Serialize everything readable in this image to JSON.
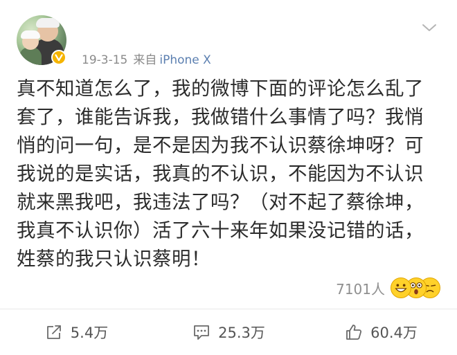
{
  "post": {
    "timestamp": "19-3-15",
    "source_prefix": "来自",
    "device": "iPhone X",
    "text": "真不知道怎么了，我的微博下面的评论怎么乱了套了，谁能告诉我，我做错什么事情了吗？我悄悄的问一句，是不是因为我不认识蔡徐坤呀？可我说的是实话，我真的不认识，不能因为不认识就来黑我吧，我违法了吗？（对不起了蔡徐坤，我真不认识你）活了六十来年如果没记错的话，姓蔡的我只认识蔡明！"
  },
  "reactions": {
    "count": "7101人",
    "emojis": [
      "grin-emoji",
      "surprised-emoji",
      "sad-emoji"
    ]
  },
  "actions": {
    "repost": {
      "icon": "repost-icon",
      "label": "5.4万"
    },
    "comment": {
      "icon": "comment-icon",
      "label": "25.3万"
    },
    "like": {
      "icon": "thumbs-up-icon",
      "label": "60.4万"
    }
  },
  "colors": {
    "text": "#2c2c2c",
    "meta": "#8a8a8a",
    "device_link": "#5b7fb0",
    "badge": "#f5b400"
  }
}
